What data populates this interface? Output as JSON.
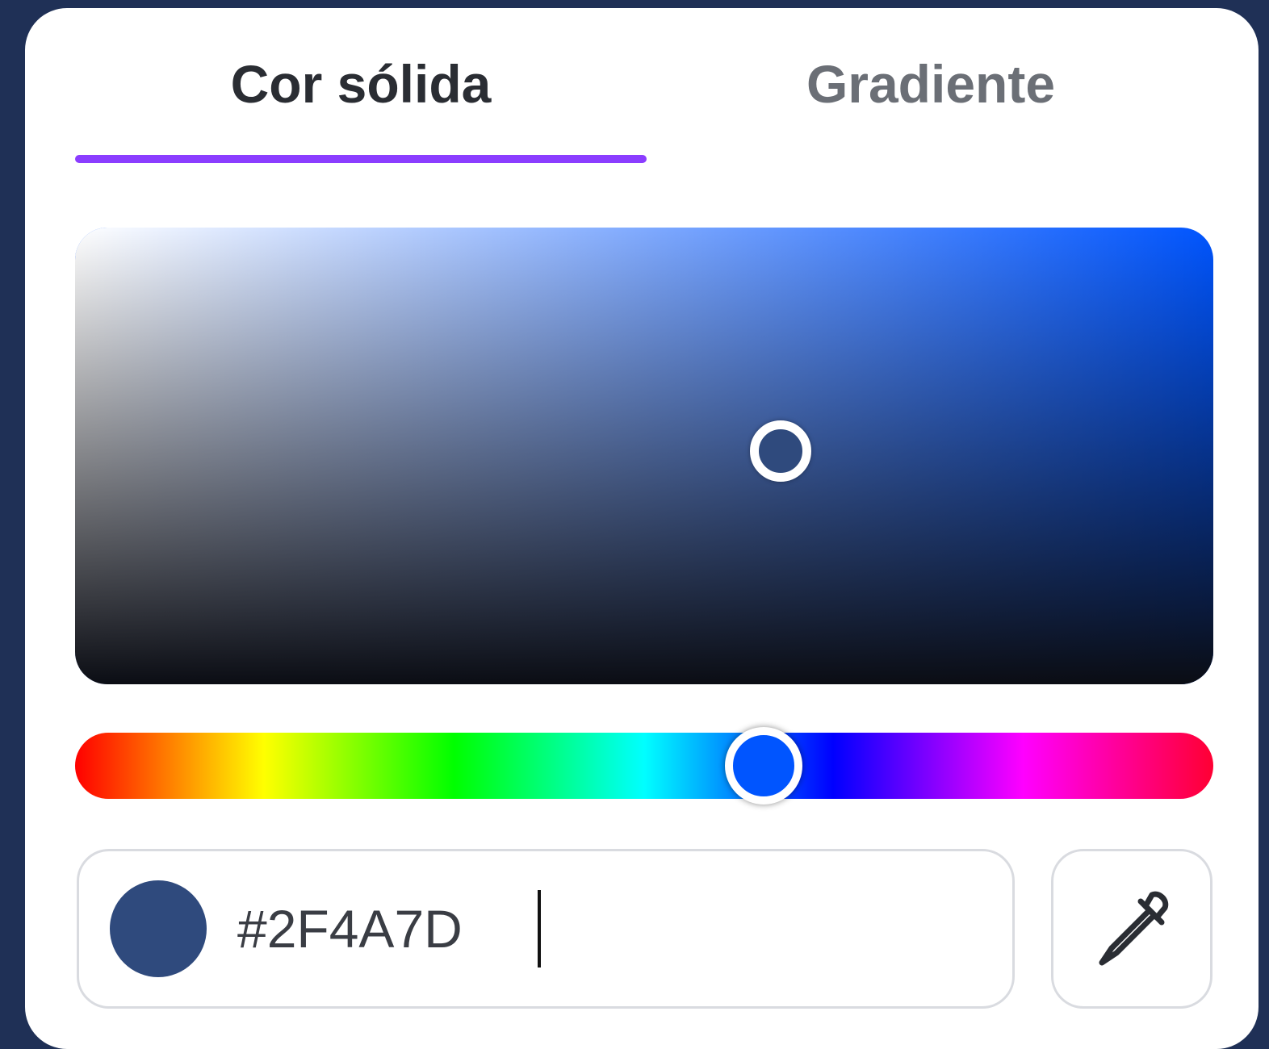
{
  "tabs": {
    "solid_label": "Cor sólida",
    "gradient_label": "Gradiente",
    "active": "solid"
  },
  "colors": {
    "accent": "#8b3dff",
    "hue_color": "#0055ff",
    "selected": "#2F4A7D"
  },
  "picker": {
    "saturation": 0.62,
    "value": 0.51,
    "hue_position": 0.605
  },
  "hex_input": {
    "value": "#2F4A7D"
  },
  "icons": {
    "eyedropper": "eyedropper-icon"
  }
}
